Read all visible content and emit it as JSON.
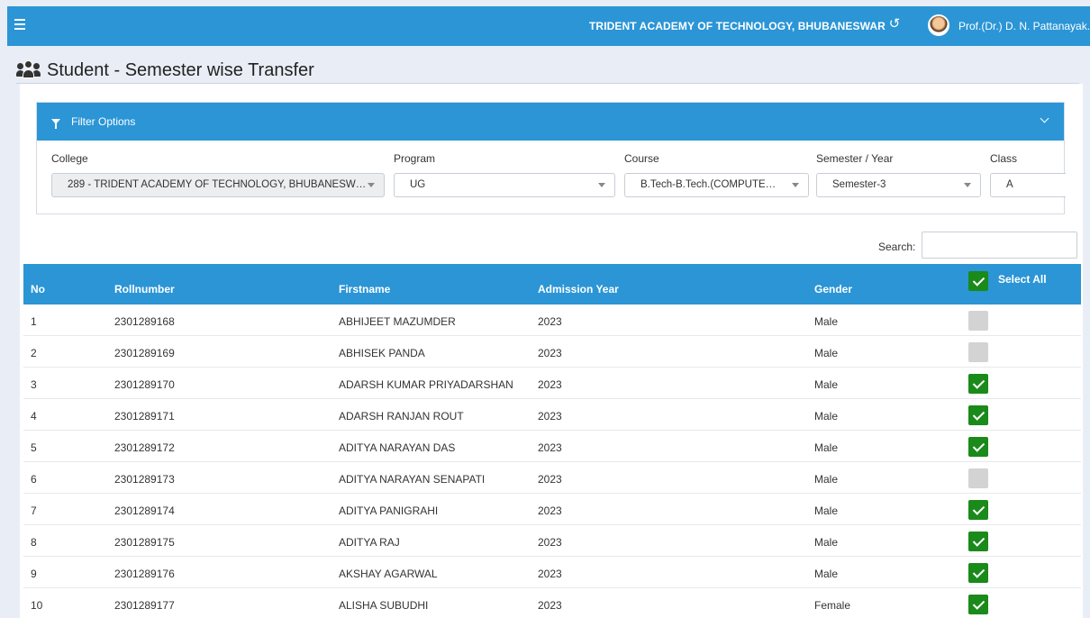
{
  "header": {
    "institution": "TRIDENT ACADEMY OF TECHNOLOGY, BHUBANESWAR",
    "user": "Prof.(Dr.) D. N. Pattanayak."
  },
  "page": {
    "title": "Student - Semester wise Transfer"
  },
  "filter": {
    "heading": "Filter Options",
    "college_label": "College",
    "college_value": "289 - TRIDENT ACADEMY OF TECHNOLOGY, BHUBANESW…",
    "program_label": "Program",
    "program_value": "UG",
    "course_label": "Course",
    "course_value": "B.Tech-B.Tech.(COMPUTE…",
    "semester_label": "Semester / Year",
    "semester_value": "Semester-3",
    "class_label": "Class",
    "class_value": "A"
  },
  "search": {
    "label": "Search:",
    "value": ""
  },
  "table": {
    "headers": {
      "no": "No",
      "roll": "Rollnumber",
      "first": "Firstname",
      "year": "Admission Year",
      "gender": "Gender",
      "select_all": "Select All"
    },
    "select_all_checked": true,
    "rows": [
      {
        "no": "1",
        "roll": "2301289168",
        "first": "ABHIJEET MAZUMDER",
        "year": "2023",
        "gender": "Male",
        "checked": false
      },
      {
        "no": "2",
        "roll": "2301289169",
        "first": "ABHISEK PANDA",
        "year": "2023",
        "gender": "Male",
        "checked": false
      },
      {
        "no": "3",
        "roll": "2301289170",
        "first": "ADARSH KUMAR PRIYADARSHAN",
        "year": "2023",
        "gender": "Male",
        "checked": true
      },
      {
        "no": "4",
        "roll": "2301289171",
        "first": "ADARSH RANJAN ROUT",
        "year": "2023",
        "gender": "Male",
        "checked": true
      },
      {
        "no": "5",
        "roll": "2301289172",
        "first": "ADITYA NARAYAN DAS",
        "year": "2023",
        "gender": "Male",
        "checked": true
      },
      {
        "no": "6",
        "roll": "2301289173",
        "first": "ADITYA NARAYAN SENAPATI",
        "year": "2023",
        "gender": "Male",
        "checked": false
      },
      {
        "no": "7",
        "roll": "2301289174",
        "first": "ADITYA PANIGRAHI",
        "year": "2023",
        "gender": "Male",
        "checked": true
      },
      {
        "no": "8",
        "roll": "2301289175",
        "first": "ADITYA RAJ",
        "year": "2023",
        "gender": "Male",
        "checked": true
      },
      {
        "no": "9",
        "roll": "2301289176",
        "first": "AKSHAY AGARWAL",
        "year": "2023",
        "gender": "Male",
        "checked": true
      },
      {
        "no": "10",
        "roll": "2301289177",
        "first": "ALISHA SUBUDHI",
        "year": "2023",
        "gender": "Female",
        "checked": true
      }
    ]
  },
  "colors": {
    "primary": "#2b95d6",
    "checked": "#1a8a1a",
    "unchecked": "#d3d3d3"
  }
}
